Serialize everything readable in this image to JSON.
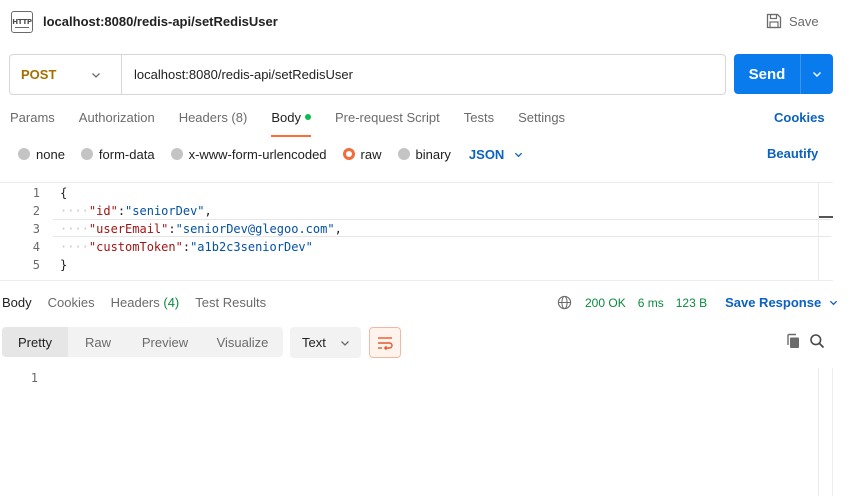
{
  "tab": {
    "title": "localhost:8080/redis-api/setRedisUser",
    "badge": "HTTP",
    "save_label": "Save"
  },
  "request": {
    "method": "POST",
    "url": "localhost:8080/redis-api/setRedisUser",
    "send_label": "Send"
  },
  "request_tabs": [
    {
      "label": "Params"
    },
    {
      "label": "Authorization"
    },
    {
      "label": "Headers (8)"
    },
    {
      "label": "Body"
    },
    {
      "label": "Pre-request Script"
    },
    {
      "label": "Tests"
    },
    {
      "label": "Settings"
    }
  ],
  "cookies_label": "Cookies",
  "body_types": [
    {
      "label": "none"
    },
    {
      "label": "form-data"
    },
    {
      "label": "x-www-form-urlencoded"
    },
    {
      "label": "raw"
    },
    {
      "label": "binary"
    }
  ],
  "body_format": "JSON",
  "beautify_label": "Beautify",
  "code": {
    "line_numbers": [
      "1",
      "2",
      "3",
      "4",
      "5"
    ],
    "open_brace": "{",
    "close_brace": "}",
    "fields": [
      {
        "key": "\"id\"",
        "value": "\"seniorDev\"",
        "trail": ","
      },
      {
        "key": "\"userEmail\"",
        "value": "\"seniorDev@glegoo.com\"",
        "trail": ","
      },
      {
        "key": "\"customToken\"",
        "value": "\"a1b2c3seniorDev\"",
        "trail": ""
      }
    ]
  },
  "response_tabs": [
    {
      "label": "Body"
    },
    {
      "label": "Cookies"
    },
    {
      "label": "Headers",
      "count": "(4)"
    },
    {
      "label": "Test Results"
    }
  ],
  "response_meta": {
    "status": "200 OK",
    "time": "6 ms",
    "size": "123 B",
    "save_label": "Save Response"
  },
  "view_modes": [
    {
      "label": "Pretty"
    },
    {
      "label": "Raw"
    },
    {
      "label": "Preview"
    },
    {
      "label": "Visualize"
    }
  ],
  "response_format": "Text",
  "response_line_numbers": [
    "1"
  ],
  "colors": {
    "accent_blue": "#097bed",
    "link_blue": "#0b62c0",
    "method_post": "#a66f00",
    "success_green": "#0a8a3e",
    "active_orange": "#ff6c37"
  }
}
